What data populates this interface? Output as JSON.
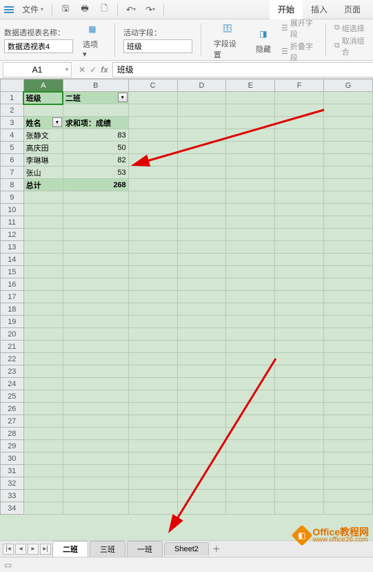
{
  "menubar": {
    "file_label": "文件",
    "tabs": {
      "start": "开始",
      "insert": "插入",
      "page": "页面"
    }
  },
  "ribbon": {
    "pivot_name_label": "数据透视表名称：",
    "pivot_name_value": "数据透视表4",
    "options_label": "选项",
    "active_field_label": "活动字段：",
    "active_field_value": "班级",
    "field_settings": "字段设置",
    "hide": "隐藏",
    "expand_field": "展开字段",
    "collapse_field": "折叠字段",
    "group_sel": "组选择",
    "ungroup": "取消组合"
  },
  "namebox": "A1",
  "formula_value": "班级",
  "columns": [
    "A",
    "B",
    "C",
    "D",
    "E",
    "F",
    "G"
  ],
  "rows_count": 34,
  "pivot": {
    "a1": "班级",
    "b1": "二班",
    "a3": "姓名",
    "b3": "求和项：成绩",
    "data": [
      {
        "name": "张静文",
        "score": 83
      },
      {
        "name": "高庆田",
        "score": 50
      },
      {
        "name": "李琳琳",
        "score": 82
      },
      {
        "name": "张山",
        "score": 53
      }
    ],
    "total_label": "总计",
    "total_value": 268
  },
  "chart_data": {
    "type": "table",
    "title": "求和项：成绩 (二班)",
    "categories": [
      "张静文",
      "高庆田",
      "李琳琳",
      "张山"
    ],
    "values": [
      83,
      50,
      82,
      53
    ],
    "total": 268
  },
  "sheet_tabs": {
    "active": "二班",
    "others": [
      "三班",
      "一班",
      "Sheet2"
    ]
  },
  "watermark": {
    "main": "Office教程网",
    "sub": "www.office26.com"
  }
}
